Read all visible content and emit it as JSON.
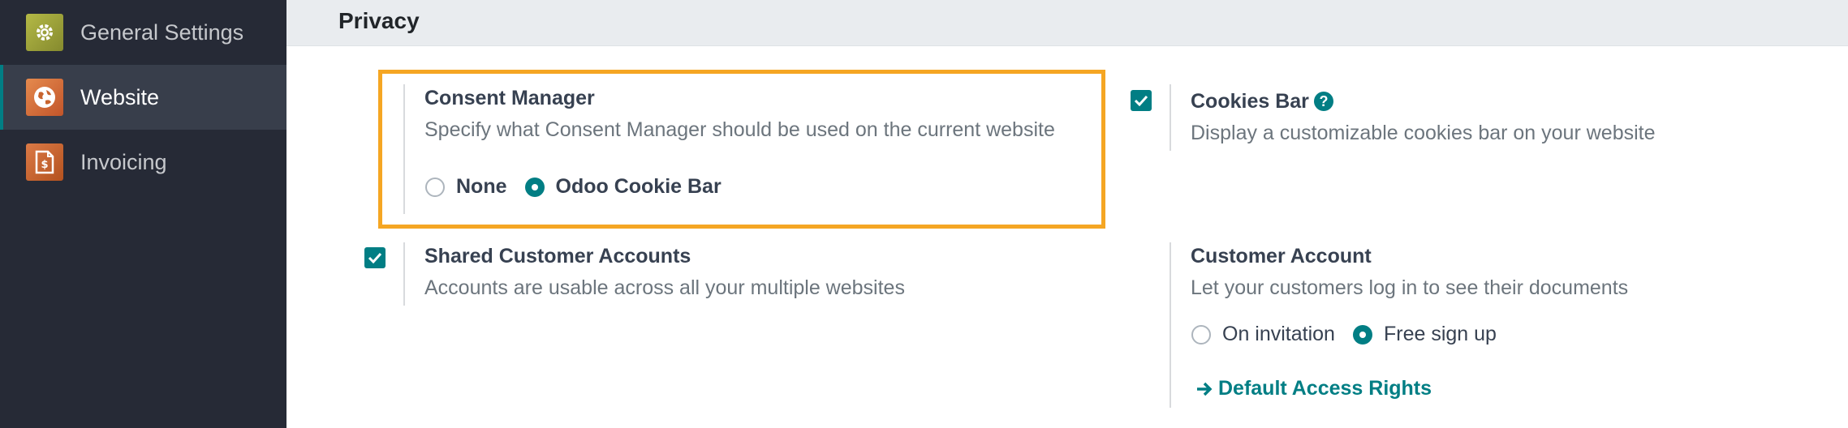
{
  "sidebar": {
    "items": [
      {
        "label": "General Settings",
        "icon": "gear-icon",
        "color": "#9a9f3c"
      },
      {
        "label": "Website",
        "icon": "globe-icon",
        "color": "#d9743f"
      },
      {
        "label": "Invoicing",
        "icon": "invoice-icon",
        "color": "#c8642e"
      }
    ]
  },
  "section": {
    "title": "Privacy"
  },
  "consent_manager": {
    "title": "Consent Manager",
    "description": "Specify what Consent Manager should be used on the current website",
    "options": [
      {
        "label": "None",
        "checked": false
      },
      {
        "label": "Odoo Cookie Bar",
        "checked": true
      }
    ]
  },
  "cookies_bar": {
    "title": "Cookies Bar",
    "help": "?",
    "description": "Display a customizable cookies bar on your website",
    "checked": true
  },
  "shared_accounts": {
    "title": "Shared Customer Accounts",
    "description": "Accounts are usable across all your multiple websites",
    "checked": true
  },
  "customer_account": {
    "title": "Customer Account",
    "description": "Let your customers log in to see their documents",
    "options": [
      {
        "label": "On invitation",
        "checked": false
      },
      {
        "label": "Free sign up",
        "checked": true
      }
    ],
    "link": "Default Access Rights"
  },
  "colors": {
    "accent": "#017e84",
    "highlight": "#f5a623",
    "sidebar": "#262a36"
  }
}
